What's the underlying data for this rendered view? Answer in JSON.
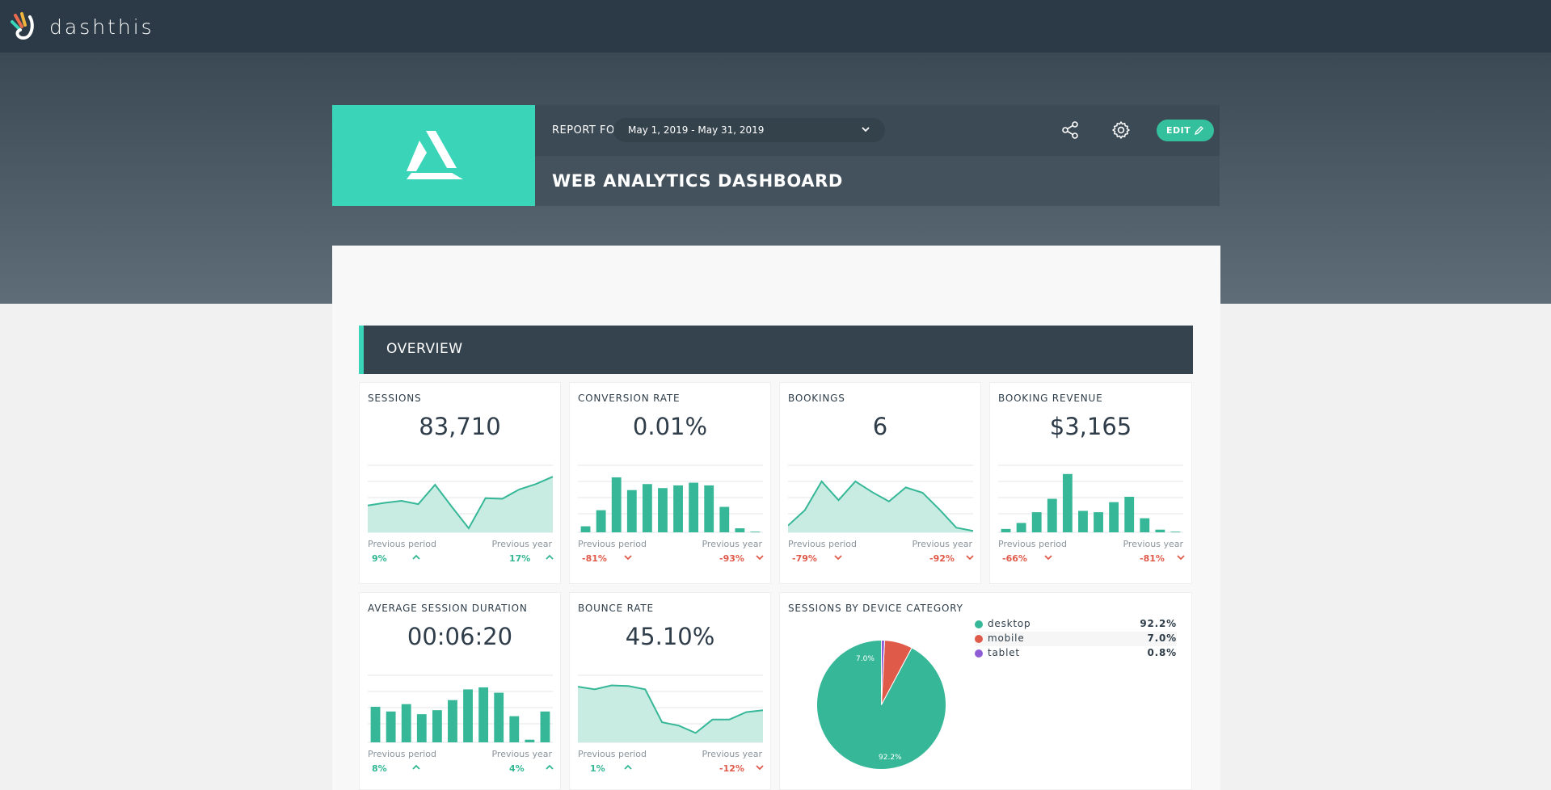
{
  "app": {
    "brand": "dashthis"
  },
  "report": {
    "report_for_label": "REPORT FOR",
    "date_range": "May 1, 2019 - May 31, 2019",
    "title": "WEB ANALYTICS DASHBOARD",
    "edit_label": "EDIT"
  },
  "section": {
    "title": "OVERVIEW"
  },
  "colors": {
    "accent": "#3ad5b8",
    "positive": "#32b793",
    "negative": "#e05a4a",
    "header_dark": "#2b3a46"
  },
  "widgets": {
    "sessions": {
      "title": "SESSIONS",
      "value": "83,710",
      "prev_period_label": "Previous period",
      "prev_period": "9%",
      "prev_period_dir": "up",
      "prev_year_label": "Previous year",
      "prev_year": "17%",
      "prev_year_dir": "up"
    },
    "conversion": {
      "title": "CONVERSION RATE",
      "value": "0.01%",
      "prev_period_label": "Previous period",
      "prev_period": "-81%",
      "prev_period_dir": "down",
      "prev_year_label": "Previous year",
      "prev_year": "-93%",
      "prev_year_dir": "down"
    },
    "bookings": {
      "title": "BOOKINGS",
      "value": "6",
      "prev_period_label": "Previous period",
      "prev_period": "-79%",
      "prev_period_dir": "down",
      "prev_year_label": "Previous year",
      "prev_year": "-92%",
      "prev_year_dir": "down"
    },
    "revenue": {
      "title": "BOOKING REVENUE",
      "value": "$3,165",
      "prev_period_label": "Previous period",
      "prev_period": "-66%",
      "prev_period_dir": "down",
      "prev_year_label": "Previous year",
      "prev_year": "-81%",
      "prev_year_dir": "down"
    },
    "duration": {
      "title": "AVERAGE SESSION DURATION",
      "value": "00:06:20",
      "prev_period_label": "Previous period",
      "prev_period": "8%",
      "prev_period_dir": "up",
      "prev_year_label": "Previous year",
      "prev_year": "4%",
      "prev_year_dir": "up"
    },
    "bounce": {
      "title": "BOUNCE RATE",
      "value": "45.10%",
      "prev_period_label": "Previous period",
      "prev_period": "1%",
      "prev_period_dir": "up",
      "prev_year_label": "Previous year",
      "prev_year": "-12%",
      "prev_year_dir": "down"
    },
    "device": {
      "title": "SESSIONS BY DEVICE CATEGORY",
      "legend": [
        {
          "name": "desktop",
          "value": "92.2%",
          "color": "#36b898"
        },
        {
          "name": "mobile",
          "value": "7.0%",
          "color": "#e05a4a"
        },
        {
          "name": "tablet",
          "value": "0.8%",
          "color": "#8e5dd6"
        }
      ],
      "slice_labels": {
        "desktop": "92.2%",
        "mobile": "7.0%"
      }
    }
  },
  "chart_data": [
    {
      "id": "sessions",
      "type": "area",
      "values": [
        40,
        44,
        47,
        42,
        71,
        38,
        6,
        51,
        50,
        64,
        72,
        83
      ]
    },
    {
      "id": "conversion",
      "type": "bar",
      "values": [
        9,
        33,
        82,
        63,
        72,
        66,
        70,
        74,
        70,
        38,
        6,
        1
      ]
    },
    {
      "id": "bookings",
      "type": "area",
      "values": [
        10,
        33,
        76,
        48,
        76,
        60,
        46,
        67,
        59,
        34,
        7,
        2
      ]
    },
    {
      "id": "revenue",
      "type": "bar",
      "values": [
        5,
        14,
        30,
        50,
        87,
        32,
        30,
        45,
        53,
        21,
        4,
        1
      ]
    },
    {
      "id": "duration",
      "type": "bar",
      "values": [
        53,
        46,
        57,
        42,
        48,
        63,
        79,
        82,
        74,
        39,
        4,
        46
      ]
    },
    {
      "id": "bounce",
      "type": "area",
      "values": [
        83,
        79,
        85,
        84,
        79,
        30,
        25,
        14,
        34,
        34,
        45,
        48
      ]
    },
    {
      "id": "device",
      "type": "pie",
      "categories": [
        "desktop",
        "mobile",
        "tablet"
      ],
      "values": [
        92.2,
        7.0,
        0.8
      ]
    }
  ]
}
